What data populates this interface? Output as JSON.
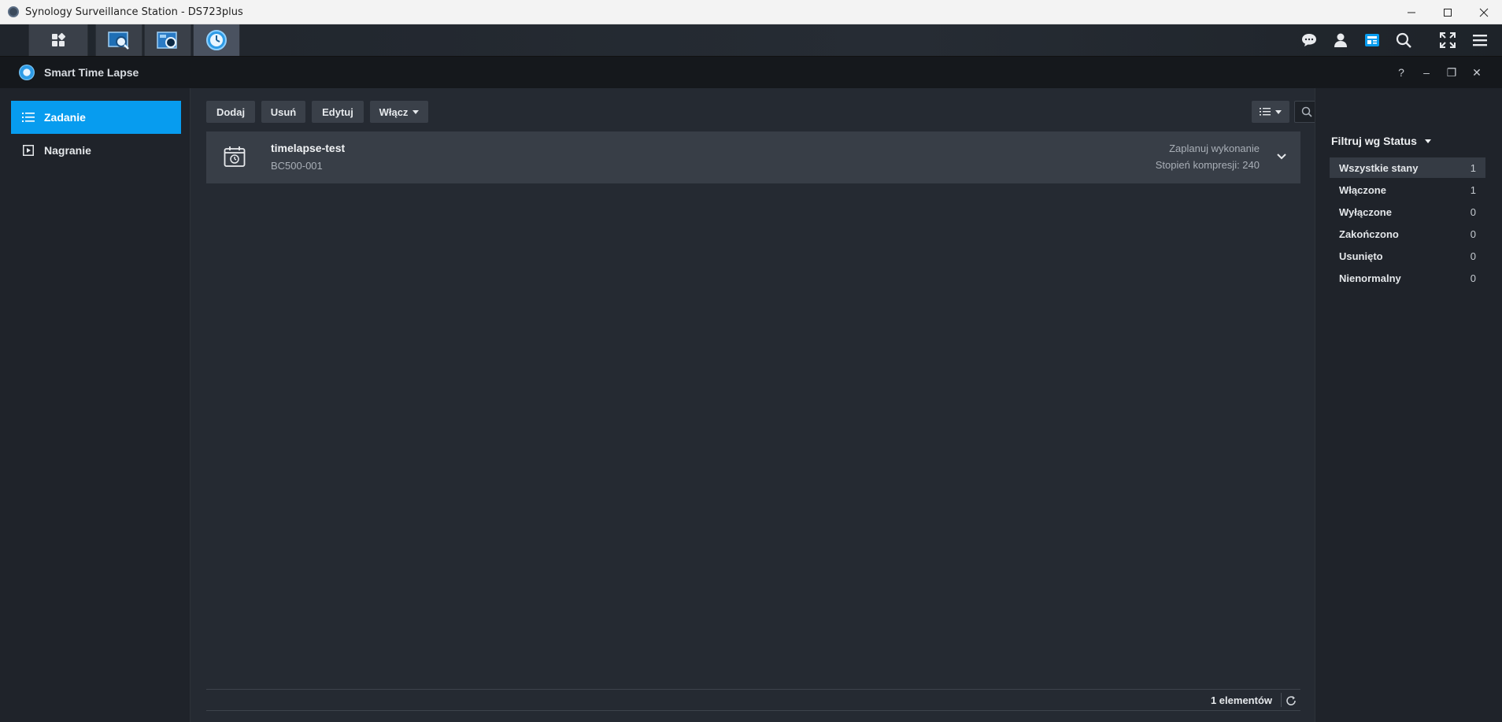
{
  "os_window": {
    "title": "Synology Surveillance Station - DS723plus",
    "controls": [
      "minimize-icon",
      "maximize-icon",
      "close-icon"
    ]
  },
  "taskbar": {
    "apps": [
      {
        "name": "app-grid-icon",
        "active": false
      },
      {
        "name": "monitor-center-icon",
        "active": false
      },
      {
        "name": "recording-icon",
        "active": false
      },
      {
        "name": "smart-time-lapse-icon",
        "active": true
      }
    ],
    "right_icons": [
      "chat-icon",
      "user-icon",
      "news-icon",
      "search-icon",
      "fullscreen-icon",
      "menu-icon"
    ],
    "accent": "#079cef"
  },
  "app": {
    "title": "Smart Time Lapse",
    "controls": {
      "help": "?",
      "minimize": "–",
      "restore": "❐",
      "close": "✕"
    }
  },
  "sidebar": {
    "items": [
      {
        "label": "Zadanie",
        "icon": "list-icon",
        "active": true
      },
      {
        "label": "Nagranie",
        "icon": "play-icon",
        "active": false
      }
    ]
  },
  "toolbar": {
    "add_label": "Dodaj",
    "delete_label": "Usuń",
    "edit_label": "Edytuj",
    "enable_label": "Włącz",
    "search_placeholder": "Szukaj"
  },
  "tasks": [
    {
      "name": "timelapse-test",
      "camera": "BC500-001",
      "status": "Zaplanuj wykonanie",
      "compression": "Stopień kompresji: 240"
    }
  ],
  "footer": {
    "count_text": "1 elementów"
  },
  "filter": {
    "title": "Filtruj wg Status",
    "items": [
      {
        "label": "Wszystkie stany",
        "count": "1",
        "active": true
      },
      {
        "label": "Włączone",
        "count": "1",
        "active": false
      },
      {
        "label": "Wyłączone",
        "count": "0",
        "active": false
      },
      {
        "label": "Zakończono",
        "count": "0",
        "active": false
      },
      {
        "label": "Usunięto",
        "count": "0",
        "active": false
      },
      {
        "label": "Nienormalny",
        "count": "0",
        "active": false
      }
    ]
  }
}
